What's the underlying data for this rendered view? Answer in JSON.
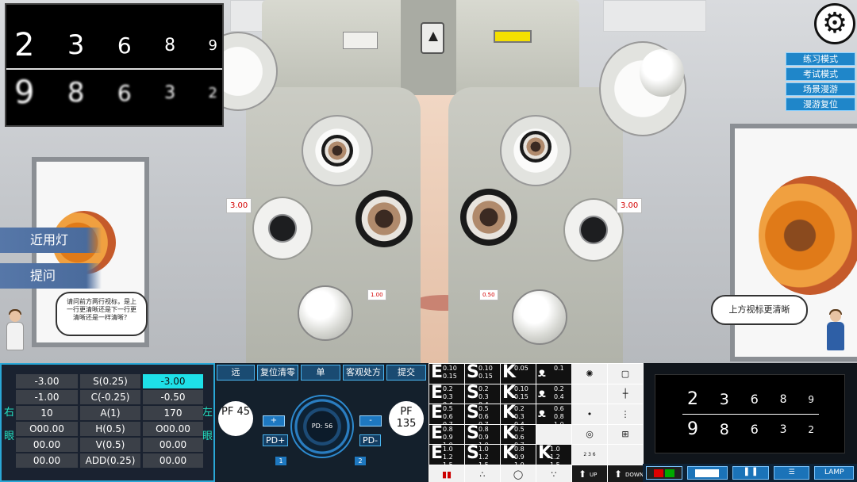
{
  "preview": {
    "row1": [
      "2",
      "3",
      "6",
      "8",
      "9"
    ],
    "row2": [
      "9",
      "8",
      "6",
      "3",
      "2"
    ]
  },
  "menu": [
    "练习模式",
    "考试模式",
    "场景漫游",
    "漫游复位"
  ],
  "side_buttons": {
    "near_light": "近用灯",
    "ask": "提问"
  },
  "speech": {
    "left": "请问前方两行视标，是上一行更清晰还是下一行更清晰还是一样清晰？",
    "right": "上方视标更清晰"
  },
  "phoropter_tags": {
    "right_sphere": "3.00",
    "left_sphere": "3.00",
    "right_cyl": "1.00",
    "left_cyl": "0.50"
  },
  "data_panel": {
    "right_label": "右眼",
    "left_label": "左眼",
    "rows": [
      [
        "-3.00",
        "S(0.25)",
        "-3.00"
      ],
      [
        "-1.00",
        "C(-0.25)",
        "-0.50"
      ],
      [
        "10",
        "A(1)",
        "170"
      ],
      [
        "O00.00",
        "H(0.5)",
        "O00.00"
      ],
      [
        "00.00",
        "V(0.5)",
        "00.00"
      ],
      [
        "00.00",
        "ADD(0.25)",
        "00.00"
      ]
    ]
  },
  "controls": {
    "tabs": [
      "远",
      "复位清零",
      "单",
      "客观处方",
      "提交"
    ],
    "pf_left": "PF 45",
    "pf_right": "PF 135",
    "plus": "+",
    "minus": "-",
    "pd_plus": "PD+",
    "pd_minus": "PD-",
    "pd_value": "PD: 56",
    "tag1": "1",
    "tag2": "2"
  },
  "optotypes": {
    "rows": [
      [
        {
          "l": "E",
          "f": "0.10\n0.15"
        },
        {
          "l": "S",
          "f": "0.10\n0.15"
        },
        {
          "l": "K",
          "f": "0.05"
        },
        {
          "t": "bird",
          "f": "0.1"
        },
        {
          "t": "radial"
        },
        {
          "t": "square"
        }
      ],
      [
        {
          "l": "E",
          "f": "0.2\n0.3\n0.4"
        },
        {
          "l": "S",
          "f": "0.2\n0.3\n0.4"
        },
        {
          "l": "K",
          "f": "0.10\n0.15"
        },
        {
          "t": "bird",
          "f": "0.2\n0.4"
        },
        {
          "t": "blank"
        },
        {
          "t": "cross"
        }
      ],
      [
        {
          "l": "E",
          "f": "0.5\n0.6\n0.7"
        },
        {
          "l": "S",
          "f": "0.5\n0.6\n0.7"
        },
        {
          "l": "K",
          "f": "0.2\n0.3\n0.4"
        },
        {
          "t": "bird",
          "f": "0.6\n0.8\n1.0"
        },
        {
          "t": "dot"
        },
        {
          "t": "bars"
        }
      ],
      [
        {
          "l": "E",
          "f": "0.8\n0.9\n1.0"
        },
        {
          "l": "S",
          "f": "0.8\n0.9\n1.0"
        },
        {
          "l": "K",
          "f": "0.5\n0.6\n0.7"
        },
        {
          "t": "blank"
        },
        {
          "t": "circle"
        },
        {
          "t": "grid"
        }
      ],
      [
        {
          "l": "E",
          "f": "1.0\n1.2\n1.5"
        },
        {
          "l": "S",
          "f": "1.0\n1.2\n1.5"
        },
        {
          "l": "K",
          "f": "0.8\n0.9\n1.0"
        },
        {
          "l": "K",
          "f": "1.0\n1.2\n1.5"
        },
        {
          "t": "numbers"
        },
        {
          "t": "blank"
        }
      ],
      [
        {
          "t": "color"
        },
        {
          "t": "dots"
        },
        {
          "t": "circle2"
        },
        {
          "t": "dots2"
        },
        {
          "t": "up",
          "f": "UP"
        },
        {
          "t": "down",
          "f": "DOWN"
        }
      ]
    ]
  },
  "chart_display": {
    "row1": [
      "2",
      "3",
      "6",
      "8",
      "9"
    ],
    "row2": [
      "9",
      "8",
      "6",
      "3",
      "2"
    ]
  },
  "bottom_bar": {
    "lamp": "LAMP"
  },
  "colors": {
    "accent": "#1e78c0",
    "highlight": "#1ee0e8",
    "label": "#23e0c0",
    "alert": "#d40000"
  }
}
